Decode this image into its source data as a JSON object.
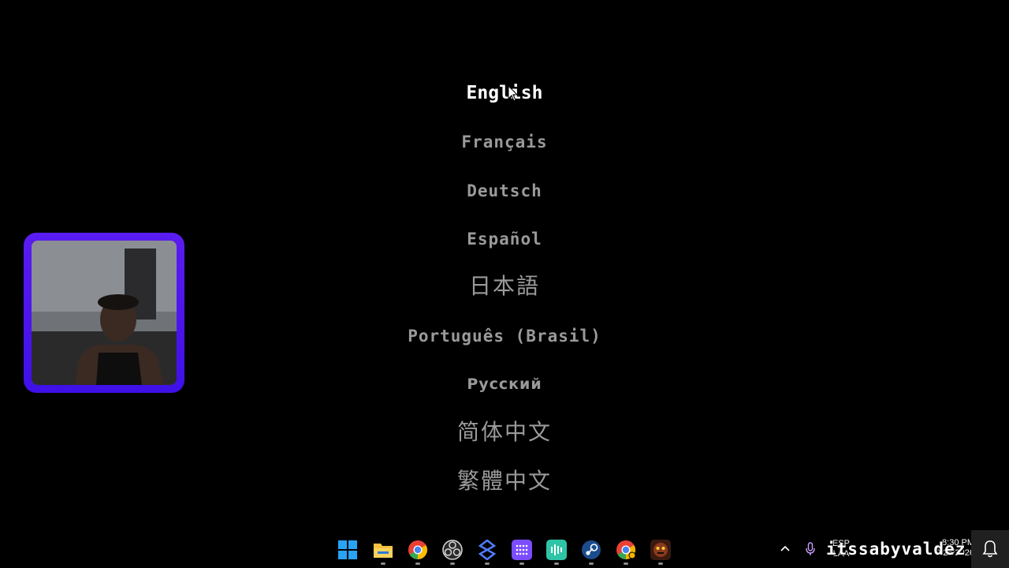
{
  "languages": [
    {
      "label": "English",
      "selected": true
    },
    {
      "label": "Français"
    },
    {
      "label": "Deutsch"
    },
    {
      "label": "Español"
    },
    {
      "label": "日本語"
    },
    {
      "label": "Português (Brasil)"
    },
    {
      "label": "Русский"
    },
    {
      "label": "简体中文"
    },
    {
      "label": "繁體中文"
    }
  ],
  "taskbar": {
    "apps": [
      {
        "name": "start-menu-icon",
        "color": "#2aa3f5"
      },
      {
        "name": "file-explorer-icon",
        "color": "#f5c23e"
      },
      {
        "name": "chrome-icon",
        "color": "#e94235"
      },
      {
        "name": "obs-icon",
        "color": "#d9d9d9"
      },
      {
        "name": "app-icon",
        "color": "#4f7cff"
      },
      {
        "name": "grid-app-icon",
        "color": "#7b4dff"
      },
      {
        "name": "audio-app-icon",
        "color": "#2ec4a6"
      },
      {
        "name": "steam-icon",
        "color": "#1b4d8c"
      },
      {
        "name": "chrome-alt-icon",
        "color": "#f4b400"
      },
      {
        "name": "game-icon",
        "color": "#8a3a1c"
      }
    ],
    "tray": {
      "language_line1": "ESP",
      "language_line2": "LAA",
      "time": "8:30 PM",
      "date": "9/25/2026"
    },
    "watermark": "itssabyvaldez"
  }
}
